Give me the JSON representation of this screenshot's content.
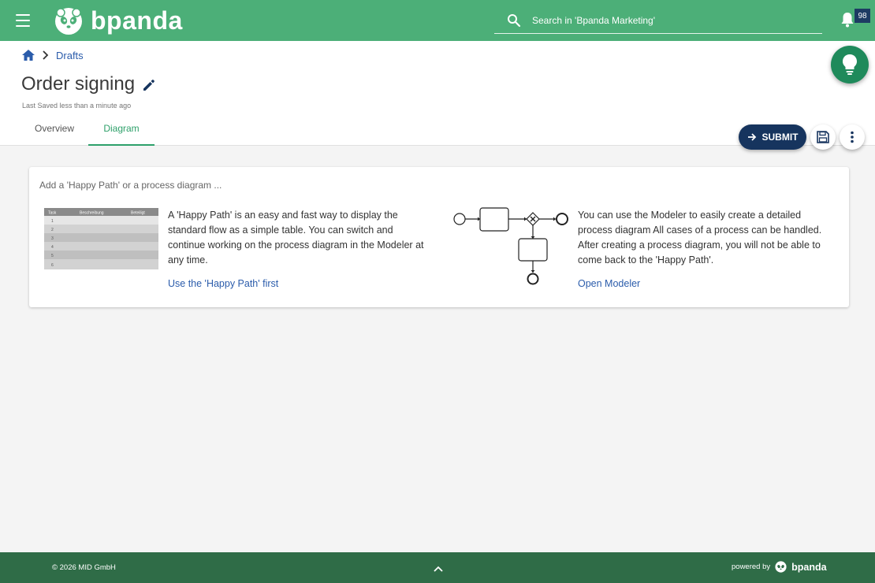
{
  "header": {
    "brand": "bpanda",
    "search_placeholder": "Search in 'Bpanda Marketing'",
    "notification_count": "98"
  },
  "breadcrumb": {
    "items": [
      "Drafts"
    ]
  },
  "page": {
    "title": "Order signing",
    "last_saved": "Last Saved less than a minute ago"
  },
  "tabs": [
    {
      "label": "Overview",
      "active": false
    },
    {
      "label": "Diagram",
      "active": true
    }
  ],
  "actions": {
    "submit_label": "SUBMIT"
  },
  "card": {
    "title": "Add a 'Happy Path' or a process diagram ...",
    "happy_path": {
      "text": "A 'Happy Path' is an easy and fast way to display the standard flow as a simple table. You can switch and continue working on the process diagram in the Modeler at any time.",
      "link": "Use the 'Happy Path' first",
      "thumb_headers": [
        "Task",
        "Beschreibung",
        "Beteiligt"
      ],
      "thumb_rows": [
        "1",
        "2",
        "3",
        "4",
        "5",
        "6"
      ]
    },
    "modeler": {
      "text": "You can use the Modeler to easily create a detailed process diagram All cases of a process can be handled. After creating a process diagram, you will not be able to come back to the 'Happy Path'.",
      "link": "Open Modeler"
    }
  },
  "footer": {
    "copyright": "© 2026 MID GmbH",
    "powered_label": "powered by",
    "powered_brand": "bpanda"
  },
  "colors": {
    "topbar": "#4caf78",
    "footer": "#2f6c47",
    "accent": "#2ea06a",
    "primary_button": "#16345e",
    "link": "#2b5cab"
  }
}
